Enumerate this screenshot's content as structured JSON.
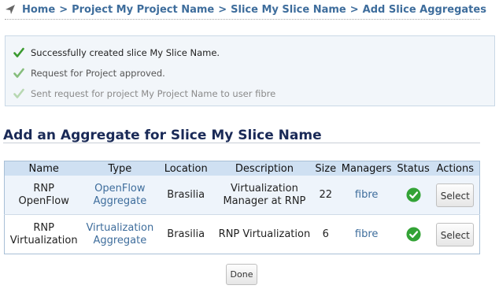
{
  "breadcrumb": {
    "items": [
      "Home",
      "Project My Project Name",
      "Slice My Slice Name",
      "Add Slice Aggregates"
    ],
    "separator": ">"
  },
  "messages": [
    "Successfully created slice My Slice Name.",
    "Request for Project approved.",
    "Sent request for project My Project Name to user fibre"
  ],
  "heading": "Add an Aggregate for Slice My Slice Name",
  "table": {
    "headers": [
      "Name",
      "Type",
      "Location",
      "Description",
      "Size",
      "Managers",
      "Status",
      "Actions"
    ],
    "rows": [
      {
        "name_l1": "RNP",
        "name_l2": "OpenFlow",
        "type_l1": "OpenFlow",
        "type_l2": "Aggregate",
        "location": "Brasilia",
        "desc_l1": "Virtualization",
        "desc_l2": "Manager at RNP",
        "size": "22",
        "manager": "fibre",
        "action": "Select"
      },
      {
        "name_l1": "RNP",
        "name_l2": "Virtualization",
        "type_l1": "Virtualization",
        "type_l2": "Aggregate",
        "location": "Brasilia",
        "desc": "RNP Virtualization",
        "size": "6",
        "manager": "fibre",
        "action": "Select"
      }
    ]
  },
  "done_label": "Done",
  "colors": {
    "link": "#3e6d9c",
    "heading": "#1a2a57",
    "status_ok": "#33a336",
    "table_header_bg": "#cfe0f2"
  },
  "icons": {
    "breadcrumb": "arrow-icon",
    "message": "checkmark-icon",
    "status": "status-ok-icon"
  }
}
